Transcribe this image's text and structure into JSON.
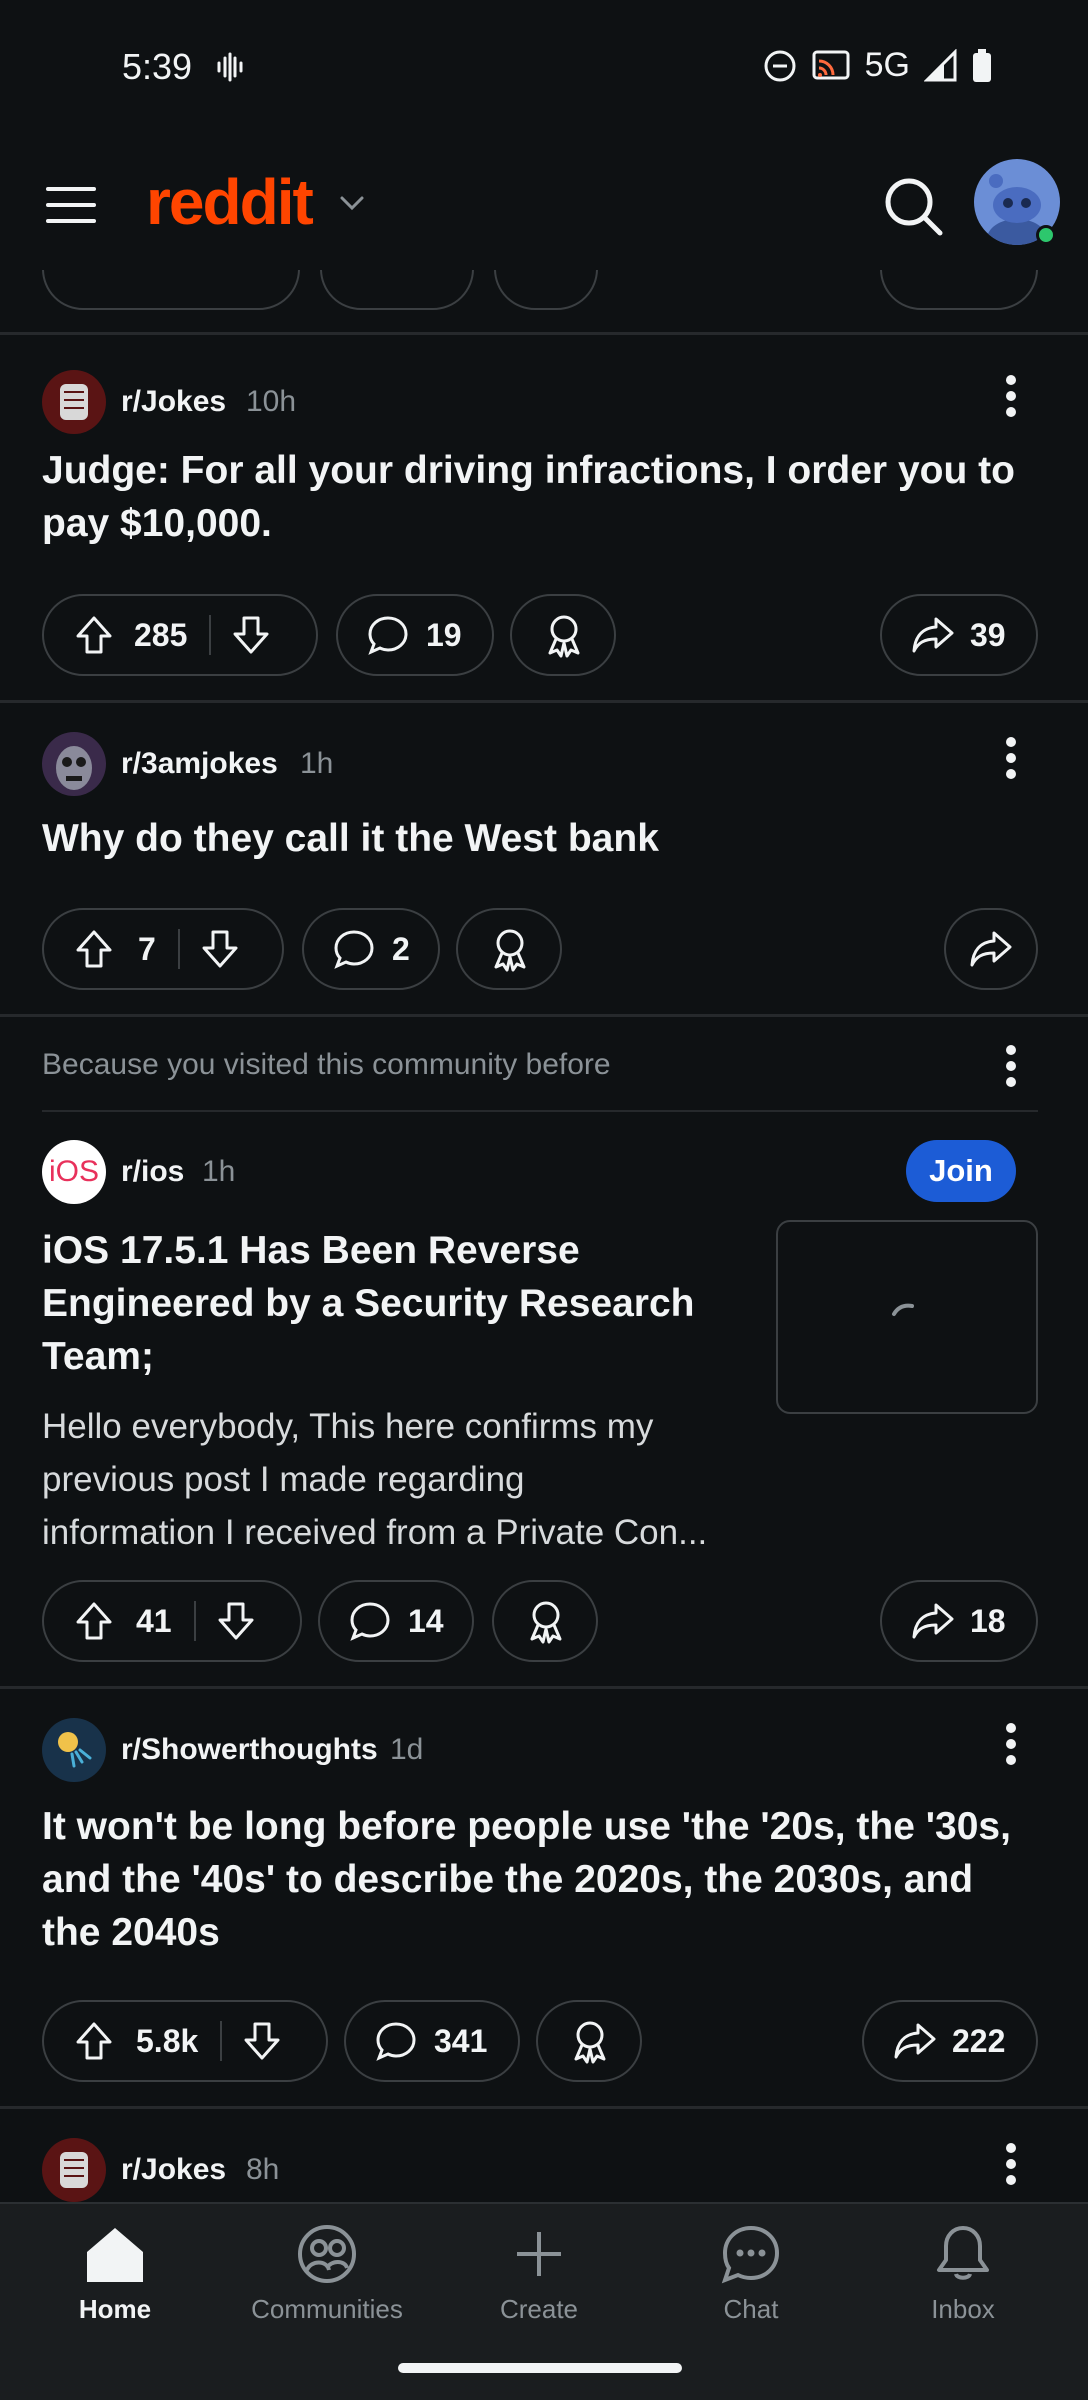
{
  "status_bar": {
    "time": "5:39",
    "network": "5G"
  },
  "header": {
    "brand": "reddit"
  },
  "posts": [
    {
      "subreddit": "r/Jokes",
      "age": "10h",
      "title_lines": [
        "Judge: For all your driving infractions, I order you to",
        "pay $10,000."
      ],
      "votes": "285",
      "comments": "19",
      "shares": "39"
    },
    {
      "subreddit": "r/3amjokes",
      "age": "1h",
      "title_lines": [
        "Why do they call it the West bank"
      ],
      "votes": "7",
      "comments": "2",
      "shares": ""
    },
    {
      "recommendation": "Because you visited this community before",
      "subreddit": "r/ios",
      "avatar_text": "iOS",
      "age": "1h",
      "join_label": "Join",
      "title_lines": [
        "iOS 17.5.1 Has Been Reverse",
        "Engineered by a Security Research",
        "Team;"
      ],
      "body_lines": [
        "Hello everybody, This here confirms my",
        "previous post I made regarding",
        "information I received from a Private Con..."
      ],
      "votes": "41",
      "comments": "14",
      "shares": "18"
    },
    {
      "subreddit": "r/Showerthoughts",
      "age": "1d",
      "title_lines": [
        "It won't be long before people use 'the '20s, the '30s,",
        "and the '40s' to describe the 2020s, the 2030s, and",
        "the 2040s"
      ],
      "votes": "5.8k",
      "comments": "341",
      "shares": "222"
    },
    {
      "subreddit": "r/Jokes",
      "age": "8h"
    }
  ],
  "nav": {
    "items": [
      {
        "label": "Home"
      },
      {
        "label": "Communities"
      },
      {
        "label": "Create"
      },
      {
        "label": "Chat"
      },
      {
        "label": "Inbox"
      }
    ]
  },
  "colors": {
    "brand": "#ff4500",
    "join": "#1c5cd6",
    "background": "#0e1113",
    "online": "#2dc76d"
  }
}
